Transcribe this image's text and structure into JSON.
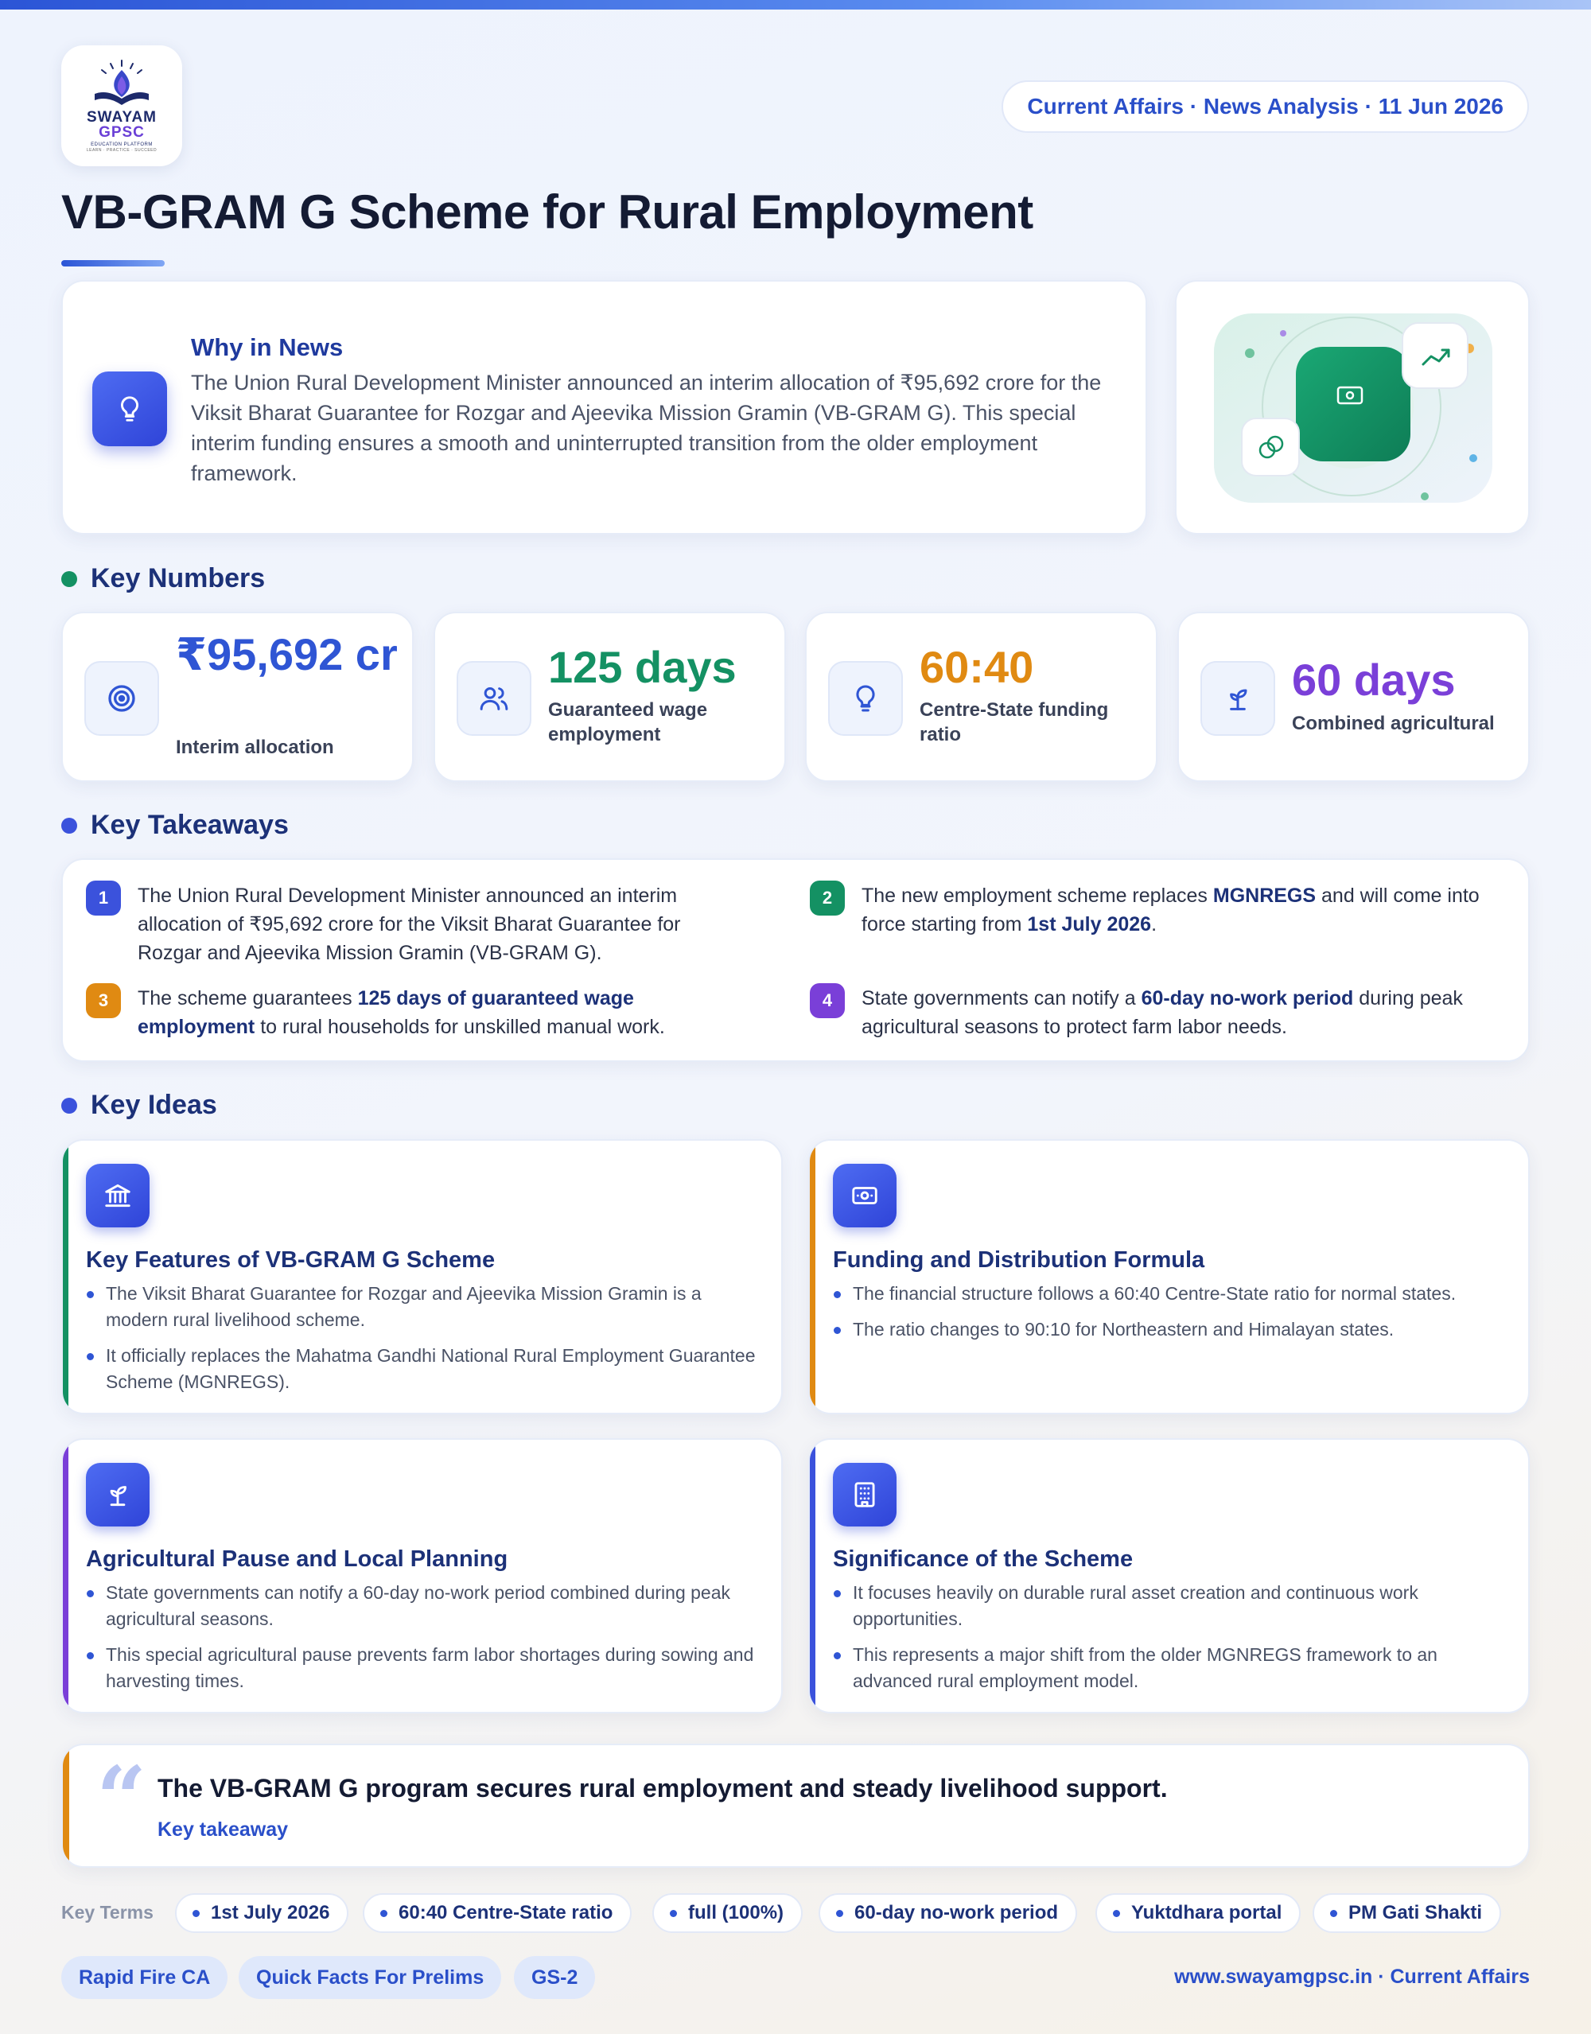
{
  "logo": {
    "line1": "SWAYAM",
    "line2": "GPSC",
    "line3": "EDUCATION PLATFORM",
    "line4": "LEARN · PRACTICE · SUCCEED"
  },
  "header": {
    "meta": "Current Affairs · News Analysis · 11 Jun 2026",
    "title": "VB-GRAM G Scheme for Rural Employment"
  },
  "why": {
    "heading": "Why in News",
    "icon": "lightbulb-icon",
    "body": "The Union Rural Development Minister announced an interim allocation of ₹95,692 crore for the Viksit Bharat Guarantee for Rozgar and Ajeevika Mission Gramin (VB-GRAM G). This special interim funding ensures a smooth and uninterrupted transition from the older employment framework."
  },
  "key_numbers": {
    "heading": "Key Numbers",
    "items": [
      {
        "value": "₹95,692 cr",
        "label": "Interim allocation",
        "color": "#2f55d4",
        "icon": "target-icon"
      },
      {
        "value": "125 days",
        "label": "Guaranteed wage employment",
        "color": "#149163",
        "icon": "users-icon"
      },
      {
        "value": "60:40",
        "label": "Centre-State funding ratio",
        "color": "#e08a12",
        "icon": "lightbulb-icon"
      },
      {
        "value": "60 days",
        "label": "Combined agricultural",
        "color": "#7a3fd8",
        "icon": "sprout-icon"
      }
    ]
  },
  "takeaways": {
    "heading": "Key Takeaways",
    "items": [
      {
        "n": "1",
        "color": "#3b52dc",
        "parts": [
          {
            "t": "The Union Rural Development Minister announced an interim allocation of ₹95,692 crore for the Viksit Bharat Guarantee for Rozgar and Ajeevika Mission Gramin (VB-GRAM G).",
            "b": false
          }
        ]
      },
      {
        "n": "2",
        "color": "#149163",
        "parts": [
          {
            "t": "The new employment scheme replaces ",
            "b": false
          },
          {
            "t": "MGNREGS",
            "b": true
          },
          {
            "t": " and will come into force starting from ",
            "b": false
          },
          {
            "t": "1st July 2026",
            "b": true
          },
          {
            "t": ".",
            "b": false
          }
        ]
      },
      {
        "n": "3",
        "color": "#e08a12",
        "parts": [
          {
            "t": "The scheme guarantees ",
            "b": false
          },
          {
            "t": "125 days of guaranteed wage employment",
            "b": true
          },
          {
            "t": " to rural households for unskilled manual work.",
            "b": false
          }
        ]
      },
      {
        "n": "4",
        "color": "#7a3fd8",
        "parts": [
          {
            "t": "State governments can notify a ",
            "b": false
          },
          {
            "t": "60-day no-work period",
            "b": true
          },
          {
            "t": " during peak agricultural seasons to protect farm labor needs.",
            "b": false
          }
        ]
      }
    ]
  },
  "ideas": {
    "heading": "Key Ideas",
    "items": [
      {
        "title": "Key Features of VB-GRAM G Scheme",
        "accent": "#149163",
        "icon": "bank-icon",
        "points": [
          "The Viksit Bharat Guarantee for Rozgar and Ajeevika Mission Gramin is a modern rural livelihood scheme.",
          "It officially replaces the Mahatma Gandhi National Rural Employment Guarantee Scheme (MGNREGS)."
        ]
      },
      {
        "title": "Funding and Distribution Formula",
        "accent": "#e08a12",
        "icon": "banknote-icon",
        "points": [
          "The financial structure follows a 60:40 Centre-State ratio for normal states.",
          "The ratio changes to 90:10 for Northeastern and Himalayan states."
        ]
      },
      {
        "title": "Agricultural Pause and Local Planning",
        "accent": "#7a3fd8",
        "icon": "sprout-icon",
        "points": [
          "State governments can notify a 60-day no-work period combined during peak agricultural seasons.",
          "This special agricultural pause prevents farm labor shortages during sowing and harvesting times."
        ]
      },
      {
        "title": "Significance of the Scheme",
        "accent": "#3b52dc",
        "icon": "building-icon",
        "points": [
          "It focuses heavily on durable rural asset creation and continuous work opportunities.",
          "This represents a major shift from the older MGNREGS framework to an advanced rural employment model."
        ]
      }
    ]
  },
  "quote": {
    "text": "The VB-GRAM G program secures rural employment and steady livelihood support.",
    "subtitle": "Key takeaway"
  },
  "terms": {
    "label": "Key Terms",
    "items": [
      "1st July 2026",
      "60:40 Centre-State ratio",
      "full (100%)",
      "60-day no-work period",
      "Yuktdhara portal",
      "PM Gati Shakti"
    ]
  },
  "footer": {
    "tags": [
      "Rapid Fire CA",
      "Quick Facts For Prelims",
      "GS-2"
    ],
    "site": "www.swayamgpsc.in · Current Affairs"
  },
  "colors": {
    "primary": "#2f55d4",
    "green": "#149163",
    "orange": "#e08a12",
    "purple": "#7a3fd8",
    "navy": "#1c3178"
  }
}
